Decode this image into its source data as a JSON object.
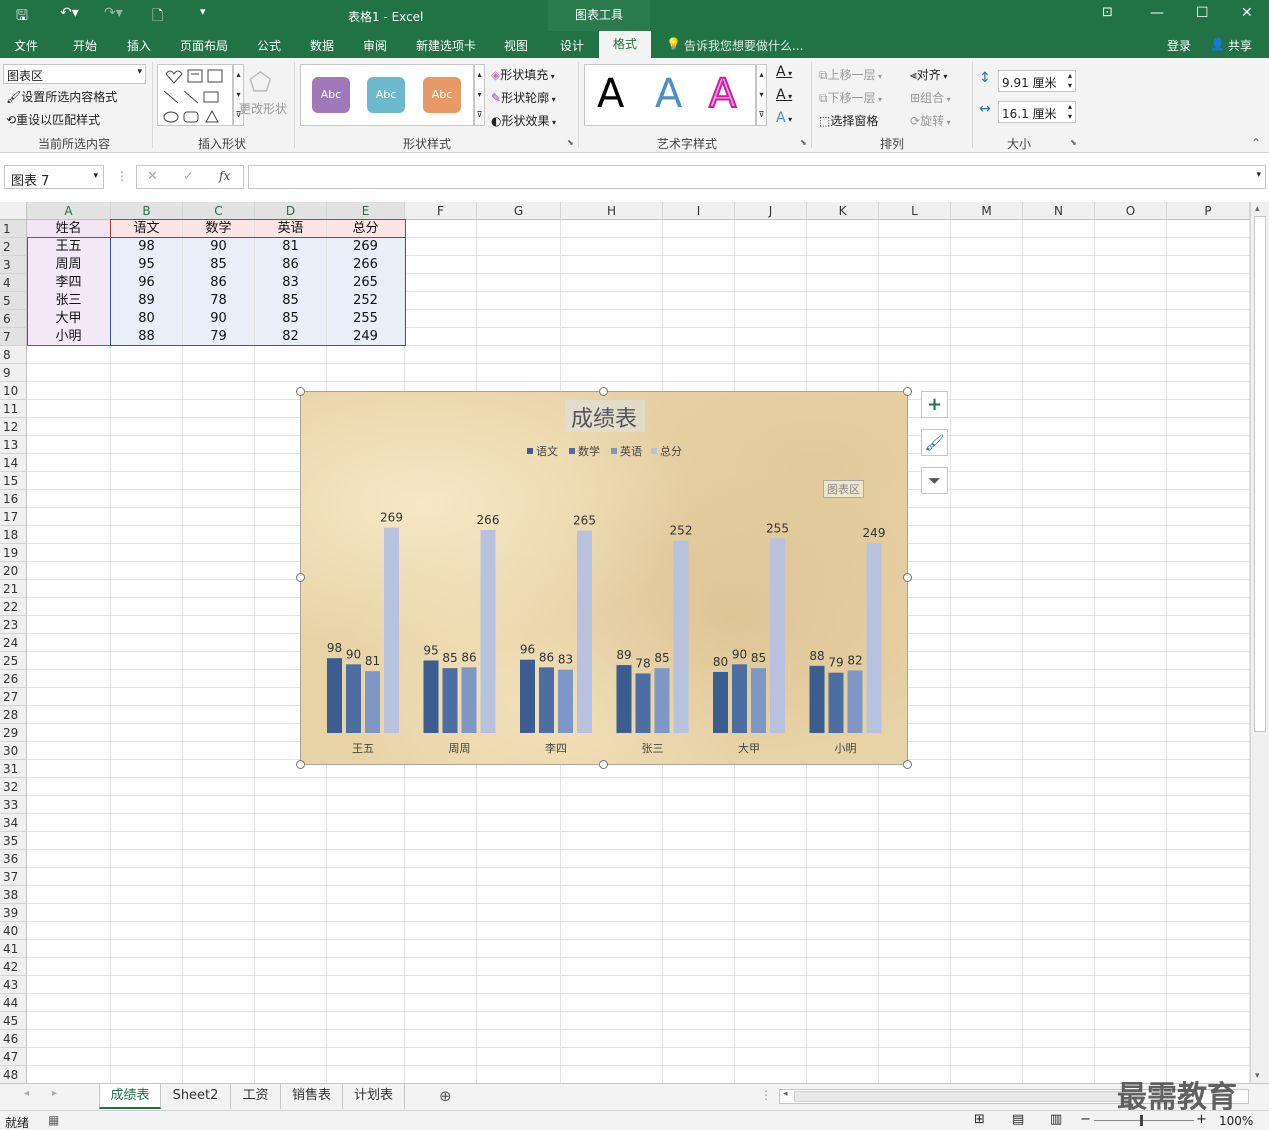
{
  "window": {
    "title": "表格1 - Excel",
    "context_tools": "图表工具",
    "signin": "登录",
    "share": "共享"
  },
  "menu": [
    "文件",
    "开始",
    "插入",
    "页面布局",
    "公式",
    "数据",
    "审阅",
    "新建选项卡",
    "视图",
    "设计",
    "格式"
  ],
  "tellme": "告诉我您想要做什么...",
  "ribbon": {
    "current_selection": {
      "dropdown": "图表区",
      "format_selection": "设置所选内容格式",
      "reset_style": "重设以匹配样式",
      "label": "当前所选内容"
    },
    "insert_shapes": {
      "change_shape": "更改形状",
      "label": "插入形状"
    },
    "shape_styles": {
      "swatch": "Abc",
      "fill": "形状填充",
      "outline": "形状轮廓",
      "effects": "形状效果",
      "label": "形状样式",
      "colors": [
        "#a07ab8",
        "#6cb8cc",
        "#e79a66"
      ]
    },
    "wordart": {
      "letter": "A",
      "label": "艺术字样式",
      "colors": [
        "#000000",
        "#4f8ec9",
        "#d21ca6"
      ]
    },
    "arrange": {
      "bring_forward": "上移一层",
      "send_backward": "下移一层",
      "selection_pane": "选择窗格",
      "align": "对齐",
      "group": "组合",
      "rotate": "旋转",
      "label": "排列"
    },
    "size": {
      "height": "9.91 厘米",
      "width": "16.1 厘米",
      "label": "大小"
    }
  },
  "formula_bar": {
    "name_box": "图表 7",
    "fx": "fx",
    "cancel": "✕",
    "enter": "✓"
  },
  "columns": [
    "A",
    "B",
    "C",
    "D",
    "E",
    "F",
    "G",
    "H",
    "I",
    "J",
    "K",
    "L",
    "M",
    "N",
    "O",
    "P"
  ],
  "table": {
    "headers": [
      "姓名",
      "语文",
      "数学",
      "英语",
      "总分"
    ],
    "rows": [
      [
        "王五",
        "98",
        "90",
        "81",
        "269"
      ],
      [
        "周周",
        "95",
        "85",
        "86",
        "266"
      ],
      [
        "李四",
        "96",
        "86",
        "83",
        "265"
      ],
      [
        "张三",
        "89",
        "78",
        "85",
        "252"
      ],
      [
        "大甲",
        "80",
        "90",
        "85",
        "255"
      ],
      [
        "小明",
        "88",
        "79",
        "82",
        "249"
      ]
    ]
  },
  "chart_data": {
    "type": "bar",
    "title": "成绩表",
    "categories": [
      "王五",
      "周周",
      "李四",
      "张三",
      "大甲",
      "小明"
    ],
    "series": [
      {
        "name": "语文",
        "values": [
          98,
          95,
          96,
          89,
          80,
          88
        ],
        "color": "#3b5d8f"
      },
      {
        "name": "数学",
        "values": [
          90,
          85,
          86,
          78,
          90,
          79
        ],
        "color": "#4d6ea3"
      },
      {
        "name": "英语",
        "values": [
          81,
          86,
          83,
          85,
          85,
          82
        ],
        "color": "#7e97c4"
      },
      {
        "name": "总分",
        "values": [
          269,
          266,
          265,
          252,
          255,
          249
        ],
        "color": "#b7c3de"
      }
    ],
    "legend": "top",
    "tooltip": "图表区",
    "ylim": [
      0,
      300
    ]
  },
  "sheets": [
    "成绩表",
    "Sheet2",
    "工资",
    "销售表",
    "计划表"
  ],
  "status": {
    "ready": "就绪",
    "zoom": "100%"
  },
  "watermark": "最需教育"
}
